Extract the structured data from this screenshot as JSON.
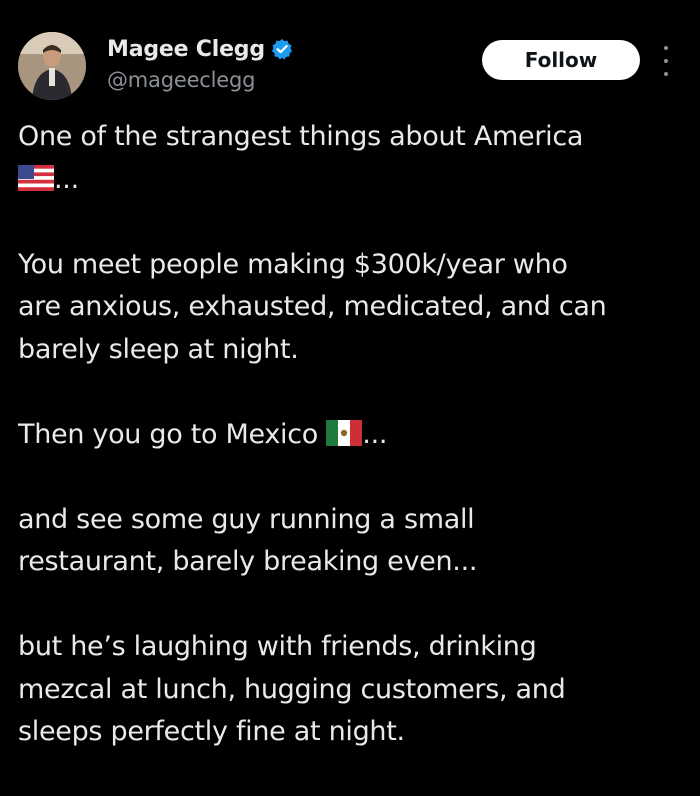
{
  "post": {
    "author": {
      "display_name": "Magee Clegg",
      "handle": "@mageeclegg",
      "verified": true,
      "verified_badge_color": "#1d9bf0"
    },
    "follow_label": "Follow",
    "more_icon": "more-vertical-icon",
    "text": {
      "p1": {
        "line1": "One of the strangest things about America",
        "line2_after_flag": "...",
        "flag": "us-flag"
      },
      "p2": {
        "line1": "You meet people making $300k/year who",
        "line2": "are anxious, exhausted, medicated, and can",
        "line3": "barely sleep at night."
      },
      "p3": {
        "line1_before_flag": "Then you go to Mexico ",
        "line1_after_flag": "...",
        "flag": "mexico-flag"
      },
      "p4": {
        "line1": "and see some guy running a small",
        "line2": "restaurant, barely breaking even..."
      },
      "p5": {
        "line1": "but he’s laughing with friends, drinking",
        "line2": "mezcal at lunch, hugging customers, and",
        "line3": "sleeps perfectly fine at night."
      }
    }
  },
  "colors": {
    "background": "#000000",
    "text_primary": "#e7e9ea",
    "text_secondary": "#8b9096",
    "button_bg": "#ffffff",
    "button_text": "#0f1419"
  }
}
